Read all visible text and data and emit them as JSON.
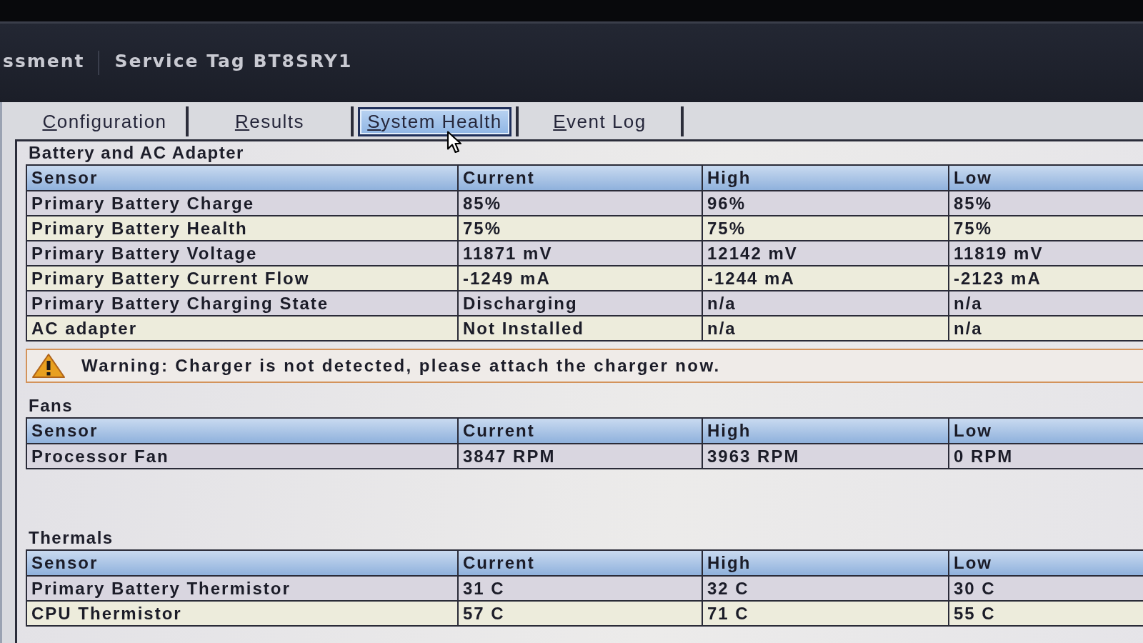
{
  "header": {
    "title": "ssment",
    "service_tag": "Service Tag BT8SRY1"
  },
  "tabs": [
    {
      "label": "Configuration",
      "selected": false
    },
    {
      "label": "Results",
      "selected": false
    },
    {
      "label": "System Health",
      "selected": true
    },
    {
      "label": "Event Log",
      "selected": false
    }
  ],
  "sections": [
    {
      "title": "Battery and AC Adapter",
      "columns": [
        "Sensor",
        "Current",
        "High",
        "Low"
      ],
      "rows": [
        [
          "Primary Battery Charge",
          "85%",
          "96%",
          "85%"
        ],
        [
          "Primary Battery Health",
          "75%",
          "75%",
          "75%"
        ],
        [
          "Primary Battery Voltage",
          "11871 mV",
          "12142 mV",
          "11819 mV"
        ],
        [
          "Primary Battery Current Flow",
          "-1249 mA",
          "-1244 mA",
          "-2123 mA"
        ],
        [
          "Primary Battery Charging State",
          "Discharging",
          "n/a",
          "n/a"
        ],
        [
          "AC adapter",
          "Not Installed",
          "n/a",
          "n/a"
        ]
      ],
      "warning": "Warning: Charger is not detected, please attach the charger now."
    },
    {
      "title": "Fans",
      "columns": [
        "Sensor",
        "Current",
        "High",
        "Low"
      ],
      "rows": [
        [
          "Processor Fan",
          "3847 RPM",
          "3963 RPM",
          "0 RPM"
        ]
      ]
    },
    {
      "title": "Thermals",
      "columns": [
        "Sensor",
        "Current",
        "High",
        "Low"
      ],
      "rows": [
        [
          "Primary Battery Thermistor",
          "31 C",
          "32 C",
          "30 C"
        ],
        [
          "CPU Thermistor",
          "57 C",
          "71 C",
          "55 C"
        ]
      ]
    }
  ]
}
